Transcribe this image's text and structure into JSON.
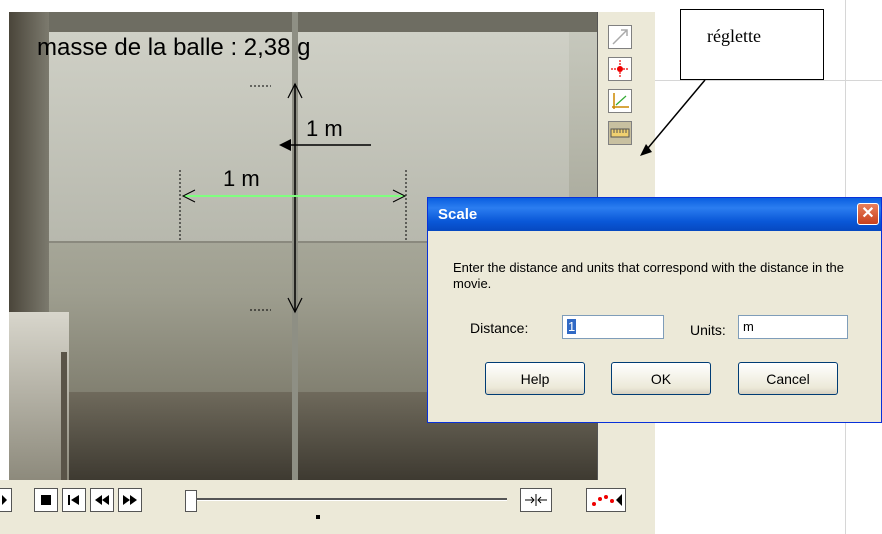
{
  "video": {
    "mass_text": "masse de la balle : 2,38 g",
    "vertical_measure": "1 m",
    "horizontal_measure": "1 m"
  },
  "callout": {
    "label": "réglette"
  },
  "toolbar": {
    "tools": [
      {
        "icon": "vector-arrow-icon"
      },
      {
        "icon": "crosshair-point-icon"
      },
      {
        "icon": "axes-icon"
      },
      {
        "icon": "ruler-icon"
      }
    ]
  },
  "controls": {
    "buttons": [
      "play-icon",
      "stop-icon",
      "step-back-icon",
      "rewind-icon",
      "fast-forward-icon"
    ]
  },
  "dialog": {
    "title": "Scale",
    "message": "Enter the distance and units that correspond with the distance in the movie.",
    "distance_label": "Distance:",
    "distance_value": "1",
    "units_label": "Units:",
    "units_value": "m",
    "help_label": "Help",
    "ok_label": "OK",
    "cancel_label": "Cancel"
  },
  "colors": {
    "titlebar": "#0a58d8",
    "measure_line": "#7fff7f",
    "dialog_bg": "#ece9d8"
  }
}
